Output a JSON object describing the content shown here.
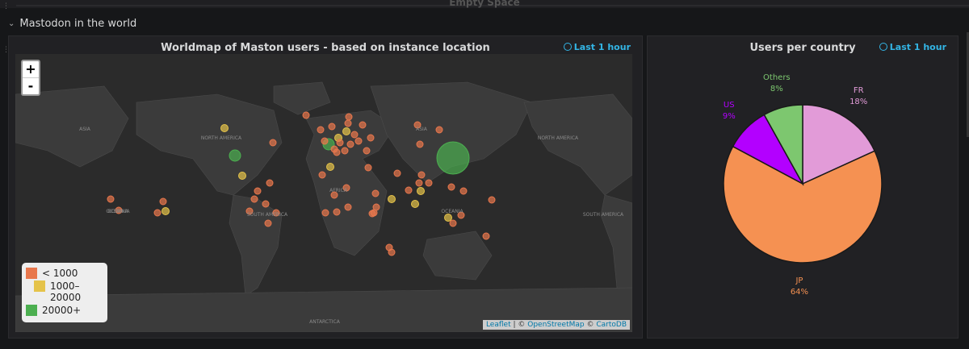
{
  "dashboard": {
    "empty_space_label": "Empty Space",
    "row_title": "Mastodon in the world"
  },
  "map_panel": {
    "title": "Worldmap of Maston users - based on instance location",
    "time_range": "Last 1 hour",
    "zoom_in": "+",
    "zoom_out": "-",
    "region_labels": [
      "ASIA",
      "NORTH AMERICA",
      "OCEANIA",
      "SOUTH AMERICA",
      "AFRICA",
      "ASIA",
      "OCEANIA",
      "NORTH AMERICA",
      "SOUTH AMERICA",
      "OCEANIA",
      "ANTARCTICA"
    ],
    "legend": [
      {
        "label": "< 1000",
        "color": "#e8774d"
      },
      {
        "label": "1000–20000",
        "color": "#e5c34a"
      },
      {
        "label": "20000+",
        "color": "#4caf50"
      }
    ],
    "attribution": {
      "leaflet": "Leaflet",
      "separator1": " | © ",
      "osm": "OpenStreetMap",
      "separator2": " © ",
      "carto": "CartoDB"
    }
  },
  "pie_panel": {
    "title": "Users per country",
    "time_range": "Last 1 hour"
  },
  "chart_data": {
    "type": "pie",
    "title": "Users per country",
    "slices": [
      {
        "name": "FR",
        "value": 18,
        "label": "18%",
        "color": "#e29bd8"
      },
      {
        "name": "JP",
        "value": 64,
        "label": "64%",
        "color": "#f59152"
      },
      {
        "name": "US",
        "value": 9,
        "label": "9%",
        "color": "#b300ff"
      },
      {
        "name": "Others",
        "value": 8,
        "label": "8%",
        "color": "#7dc76f"
      }
    ]
  }
}
